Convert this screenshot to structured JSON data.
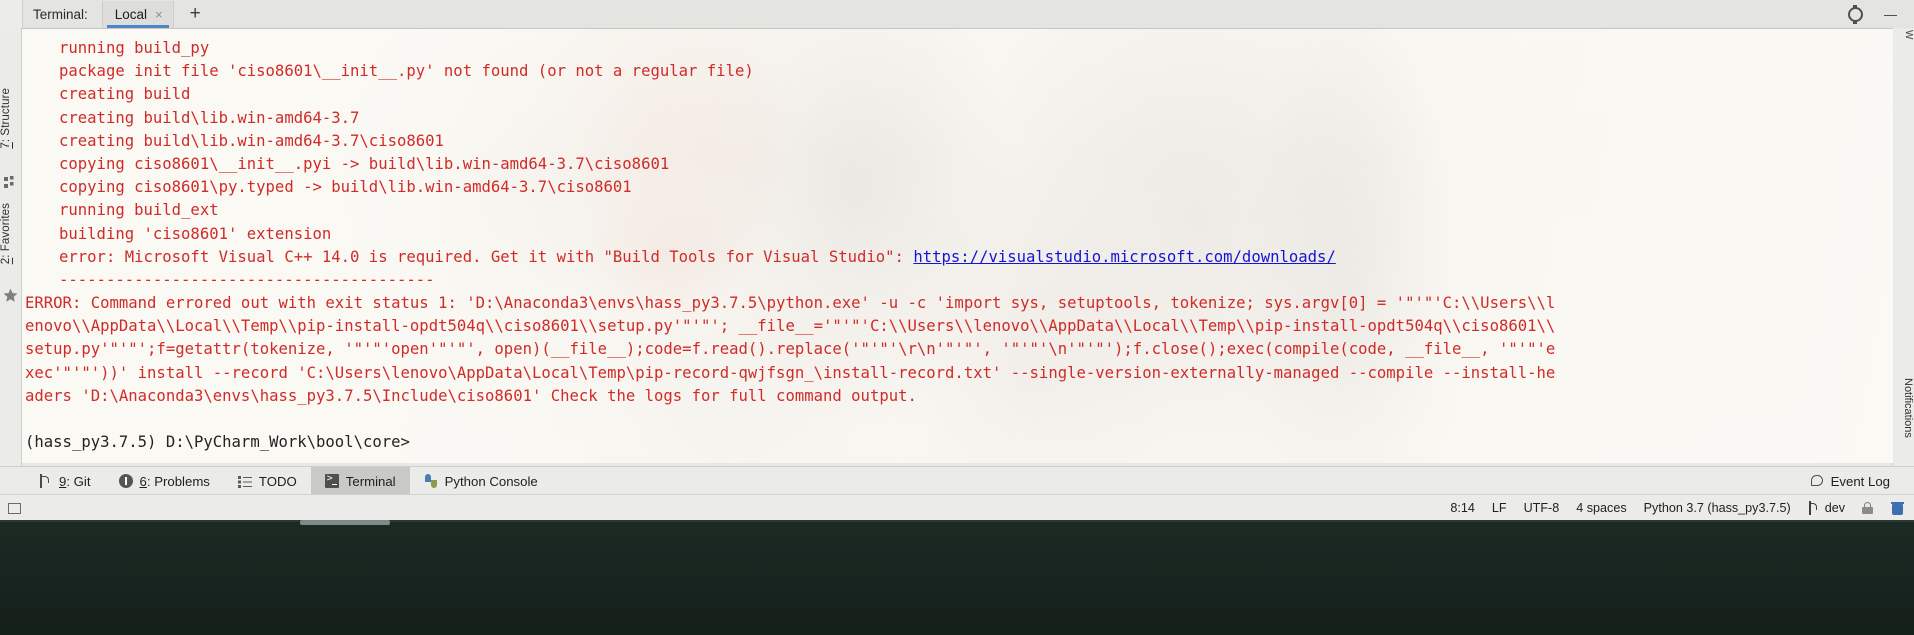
{
  "window": {
    "tabbar_label": "Terminal:",
    "tabs": [
      {
        "label": "Local",
        "close_glyph": "×",
        "active": true
      }
    ],
    "add_tab_glyph": "+",
    "tools": [
      {
        "name": "settings-gear",
        "glyph": ""
      },
      {
        "name": "hide-window",
        "glyph": ""
      }
    ]
  },
  "left_strip": {
    "items": [
      {
        "prefix": "7",
        "label": ": Structure"
      },
      {
        "prefix": "2",
        "label": ": Favorites"
      }
    ]
  },
  "right_strip": {
    "items": [
      {
        "label": "Notifications"
      },
      {
        "label": "W"
      }
    ]
  },
  "terminal": {
    "prompt": "(hass_py3.7.5) D:\\PyCharm_Work\\bool\\core>",
    "link": {
      "text": "https://visualstudio.microsoft.com/downloads/",
      "color": "#1414d6"
    },
    "error_color": "#d02b28",
    "lines": [
      {
        "indent": true,
        "text": "running build_py"
      },
      {
        "indent": true,
        "text": "package init file 'ciso8601\\__init__.py' not found (or not a regular file)"
      },
      {
        "indent": true,
        "text": "creating build"
      },
      {
        "indent": true,
        "text": "creating build\\lib.win-amd64-3.7"
      },
      {
        "indent": true,
        "text": "creating build\\lib.win-amd64-3.7\\ciso8601"
      },
      {
        "indent": true,
        "text": "copying ciso8601\\__init__.pyi -> build\\lib.win-amd64-3.7\\ciso8601"
      },
      {
        "indent": true,
        "text": "copying ciso8601\\py.typed -> build\\lib.win-amd64-3.7\\ciso8601"
      },
      {
        "indent": true,
        "text": "running build_ext"
      },
      {
        "indent": true,
        "text": "building 'ciso8601' extension"
      },
      {
        "indent": true,
        "text": "error: Microsoft Visual C++ 14.0 is required. Get it with \"Build Tools for Visual Studio\": ",
        "link": true
      },
      {
        "indent": true,
        "text": "----------------------------------------"
      },
      {
        "indent": false,
        "text": "ERROR: Command errored out with exit status 1: 'D:\\Anaconda3\\envs\\hass_py3.7.5\\python.exe' -u -c 'import sys, setuptools, tokenize; sys.argv[0] = '\"'\"'C:\\\\Users\\\\l"
      },
      {
        "indent": false,
        "text": "enovo\\\\AppData\\\\Local\\\\Temp\\\\pip-install-opdt504q\\\\ciso8601\\\\setup.py'\"'\"'; __file__='\"'\"'C:\\\\Users\\\\lenovo\\\\AppData\\\\Local\\\\Temp\\\\pip-install-opdt504q\\\\ciso8601\\\\"
      },
      {
        "indent": false,
        "text": "setup.py'\"'\"';f=getattr(tokenize, '\"'\"'open'\"'\"', open)(__file__);code=f.read().replace('\"'\"'\\r\\n'\"'\"', '\"'\"'\\n'\"'\"');f.close();exec(compile(code, __file__, '\"'\"'e"
      },
      {
        "indent": false,
        "text": "xec'\"'\"'))' install --record 'C:\\Users\\lenovo\\AppData\\Local\\Temp\\pip-record-qwjfsgn_\\install-record.txt' --single-version-externally-managed --compile --install-he"
      },
      {
        "indent": false,
        "text": "aders 'D:\\Anaconda3\\envs\\hass_py3.7.5\\Include\\ciso8601' Check the logs for full command output."
      }
    ]
  },
  "tool_window_bar": {
    "items": [
      {
        "icon": "git-icon",
        "num": "9",
        "label": ": Git",
        "selected": false
      },
      {
        "icon": "problems-icon",
        "num": "6",
        "label": ": Problems",
        "selected": false
      },
      {
        "icon": "todo-icon",
        "num": "",
        "label": "TODO",
        "selected": false
      },
      {
        "icon": "terminal-icon",
        "num": "",
        "label": "Terminal",
        "selected": true
      },
      {
        "icon": "python-icon",
        "num": "",
        "label": "Python Console",
        "selected": false
      }
    ],
    "event_log": {
      "icon": "event-log-icon",
      "label": "Event Log"
    }
  },
  "status_bar": {
    "left_icon": "toggle-sidebar-icon",
    "items": [
      {
        "name": "caret-position",
        "text": "8:14"
      },
      {
        "name": "line-separator",
        "text": "LF"
      },
      {
        "name": "file-encoding",
        "text": "UTF-8"
      },
      {
        "name": "indent-setting",
        "text": "4 spaces"
      },
      {
        "name": "interpreter",
        "text": "Python 3.7 (hass_py3.7.5)"
      }
    ],
    "branch": "dev",
    "trailing_icons": [
      {
        "name": "lock-icon"
      },
      {
        "name": "trash-icon"
      }
    ]
  },
  "os_taskbar": {
    "watermark": "",
    "clock_line1": "",
    "clock_line2": ""
  }
}
